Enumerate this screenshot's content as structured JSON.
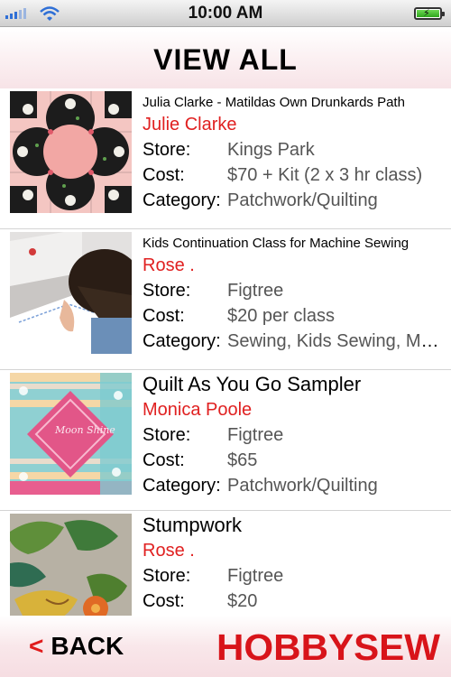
{
  "status_bar": {
    "time": "10:00 AM"
  },
  "header": {
    "title": "VIEW ALL"
  },
  "labels": {
    "store": "Store:",
    "cost": "Cost:",
    "category": "Category:"
  },
  "items": [
    {
      "title": "Julia Clarke - Matildas Own Drunkards Path",
      "teacher": "Julie Clarke",
      "store": "Kings Park",
      "cost": "$70 + Kit (2 x 3 hr class)",
      "category": "Patchwork/Quilting"
    },
    {
      "title": "Kids Continuation Class for Machine Sewing",
      "teacher": "Rose .",
      "store": "Figtree",
      "cost": "$20 per class",
      "category": "Sewing, Kids Sewing, Machine Sewing"
    },
    {
      "title": "Quilt As You Go Sampler",
      "teacher": "Monica Poole",
      "store": "Figtree",
      "cost": "$65",
      "category": "Patchwork/Quilting"
    },
    {
      "title": "Stumpwork",
      "teacher": "Rose .",
      "store": "Figtree",
      "cost": "$20",
      "category": ""
    }
  ],
  "thumb_images": {
    "item_3_text": "Moon Shine"
  },
  "footer": {
    "back_chevron": "<",
    "back_label": "BACK",
    "logo_text": "HOBBYSEW"
  },
  "colors": {
    "accent_red": "#e02020",
    "logo_red": "#d8141a",
    "header_pink": "#f7e3e7"
  }
}
